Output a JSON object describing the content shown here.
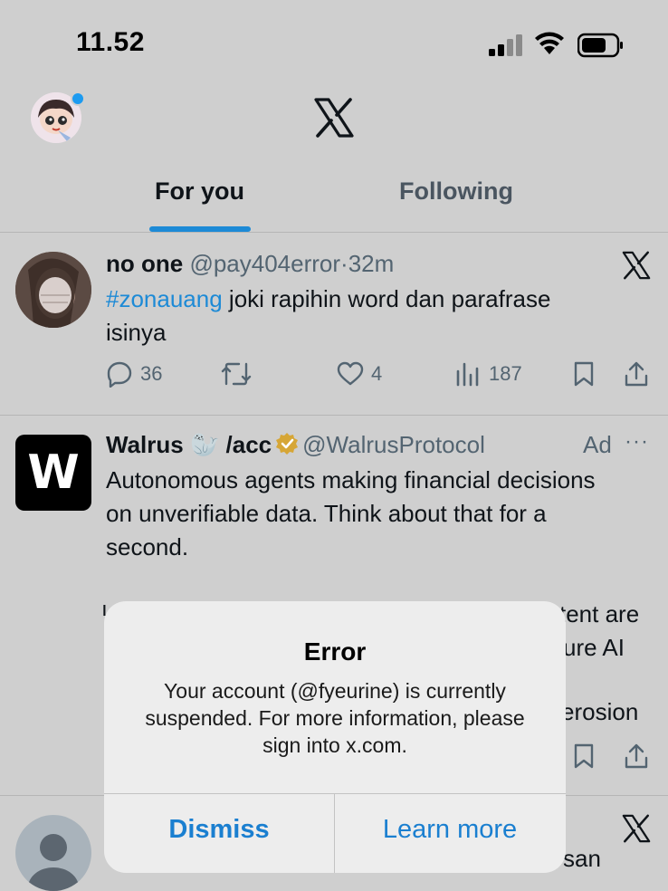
{
  "status_bar": {
    "time": "11.52"
  },
  "header": {
    "tabs": [
      {
        "label": "For you",
        "active": true
      },
      {
        "label": "Following",
        "active": false
      }
    ]
  },
  "posts": [
    {
      "name": "no one",
      "handle": "@pay404error",
      "separator": "·",
      "time": "32m",
      "hashtag": "#zonauang",
      "text_after_hashtag": " joki rapihin word dan parafrase",
      "text_line2": "isinya",
      "replies": "36",
      "likes": "4",
      "views": "187"
    },
    {
      "name": "Walrus 🦭 /acc",
      "handle": "@WalrusProtocol",
      "ad_label": "Ad",
      "more": "···",
      "logo_letter": "W",
      "text_lines": [
        "Autonomous agents making financial decisions",
        "on unverifiable data. Think about that for a",
        "second."
      ],
      "partial_right": [
        "tent are",
        "ure AI",
        "erosion"
      ]
    },
    {
      "partial_bottom": "san"
    }
  ],
  "alert": {
    "title": "Error",
    "message": "Your account (@fyeurine) is currently suspended. For more information, please sign into x.com.",
    "buttons": {
      "dismiss": "Dismiss",
      "learn_more": "Learn more"
    }
  },
  "colors": {
    "accent": "#1d8ad6",
    "background": "#cfcfcf",
    "alert_bg": "#ededed"
  },
  "icons": [
    "signal-icon",
    "wifi-icon",
    "battery-icon",
    "x-logo-icon",
    "reply-icon",
    "repost-icon",
    "like-icon",
    "views-icon",
    "bookmark-icon",
    "share-icon",
    "verified-badge-icon"
  ]
}
